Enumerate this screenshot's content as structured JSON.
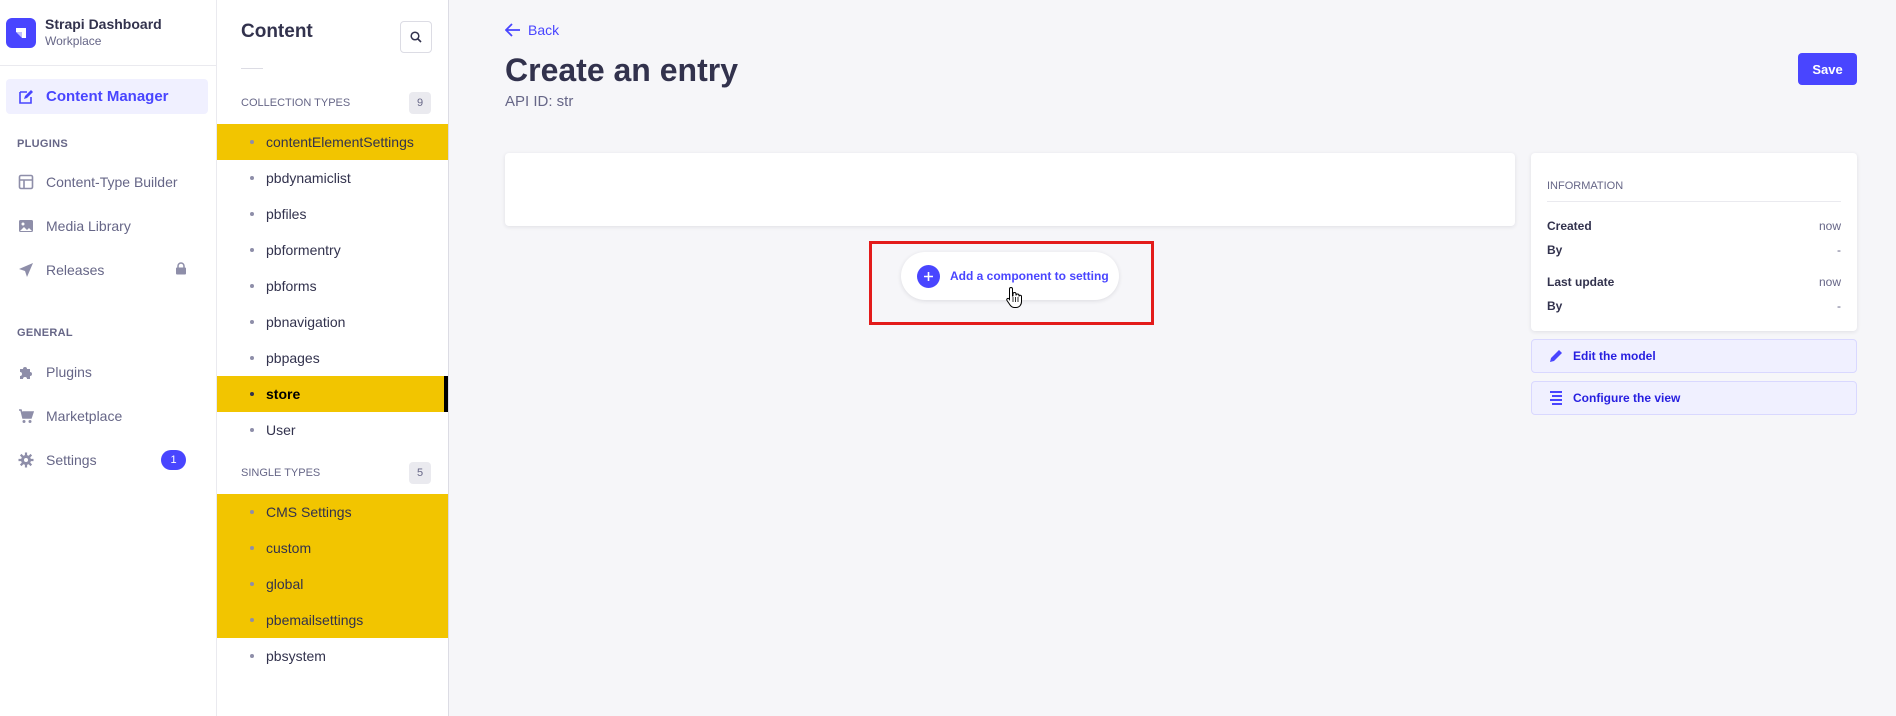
{
  "brand": {
    "title": "Strapi Dashboard",
    "subtitle": "Workplace"
  },
  "mainnav": {
    "content_manager": "Content Manager",
    "plugins_section": "PLUGINS",
    "content_type_builder": "Content-Type Builder",
    "media_library": "Media Library",
    "releases": "Releases",
    "general_section": "GENERAL",
    "plugins": "Plugins",
    "marketplace": "Marketplace",
    "settings": "Settings",
    "settings_badge": "1"
  },
  "subnav": {
    "title": "Content",
    "collection_types": {
      "label": "COLLECTION TYPES",
      "count": "9"
    },
    "collection_items": [
      "contentElementSettings",
      "pbdynamiclist",
      "pbfiles",
      "pbformentry",
      "pbforms",
      "pbnavigation",
      "pbpages",
      "store",
      "User"
    ],
    "single_types": {
      "label": "SINGLE TYPES",
      "count": "5"
    },
    "single_items": [
      "CMS Settings",
      "custom",
      "global",
      "pbemailsettings",
      "pbsystem"
    ]
  },
  "header": {
    "back": "Back",
    "title": "Create an entry",
    "api_id": "API ID: str",
    "save": "Save"
  },
  "editor": {
    "add_component": "Add a component to setting"
  },
  "information": {
    "title": "INFORMATION",
    "created_label": "Created",
    "created_value": "now",
    "created_by_label": "By",
    "created_by_value": "-",
    "updated_label": "Last update",
    "updated_value": "now",
    "updated_by_label": "By",
    "updated_by_value": "-"
  },
  "actions": {
    "edit_model": "Edit the model",
    "configure_view": "Configure the view"
  },
  "colors": {
    "primary": "#4945ff",
    "highlight": "#f2c500",
    "annotation": "#e31b1b"
  }
}
